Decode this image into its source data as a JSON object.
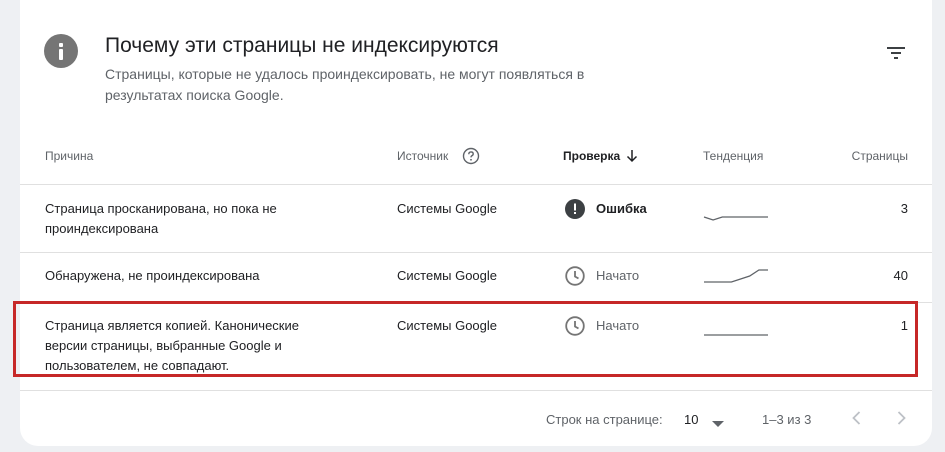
{
  "header": {
    "title": "Почему эти страницы не индексируются",
    "subtitle": "Страницы, которые не удалось проиндексировать, не могут появляться в результатах поиска Google.",
    "info_icon": "info-icon",
    "filter_icon": "filter-icon"
  },
  "table": {
    "columns": {
      "reason": "Причина",
      "source": "Источник",
      "validation": "Проверка",
      "trend": "Тенденция",
      "pages": "Страницы"
    },
    "rows": [
      {
        "reason": "Страница просканирована, но пока не проиндексирована",
        "source": "Системы Google",
        "status": "Ошибка",
        "status_icon": "error-icon",
        "trend": [
          1,
          0,
          1,
          1,
          1,
          1,
          1,
          1
        ],
        "pages": "3"
      },
      {
        "reason": "Обнаружена, не проиндексирована",
        "source": "Системы Google",
        "status": "Начато",
        "status_icon": "clock-icon",
        "trend": [
          0,
          0,
          0,
          0,
          1,
          2,
          4,
          4
        ],
        "pages": "40"
      },
      {
        "reason": "Страница является копией. Канонические версии страницы, выбранные Google и пользователем, не совпадают.",
        "source": "Системы Google",
        "status": "Начато",
        "status_icon": "clock-icon",
        "trend": [
          1,
          1,
          1,
          1,
          1,
          1,
          1,
          1
        ],
        "pages": "1"
      }
    ]
  },
  "footer": {
    "rows_per_page_label": "Строк на странице:",
    "rows_per_page_value": "10",
    "range": "1–3 из 3"
  },
  "colors": {
    "highlight": "#c62828",
    "icon_gray": "#757575",
    "error_icon": "#3c4043"
  }
}
